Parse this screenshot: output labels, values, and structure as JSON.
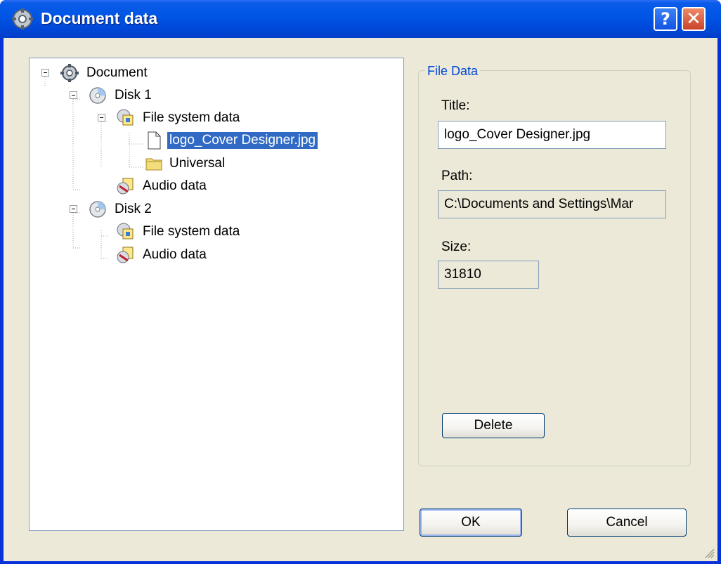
{
  "window": {
    "title": "Document data"
  },
  "titlebar_buttons": {
    "help": "?",
    "close": "✕"
  },
  "tree": {
    "root": {
      "label": "Document",
      "icon": "document-gear-icon"
    },
    "disk1": {
      "label": "Disk 1",
      "icon": "cd-disk-icon"
    },
    "disk1_fs": {
      "label": "File system data",
      "icon": "file-system-data-icon"
    },
    "disk1_file": {
      "label": "logo_Cover Designer.jpg",
      "icon": "file-icon",
      "selected": true
    },
    "disk1_folder": {
      "label": "Universal",
      "icon": "folder-icon"
    },
    "disk1_audio": {
      "label": "Audio data",
      "icon": "audio-data-icon"
    },
    "disk2": {
      "label": "Disk 2",
      "icon": "cd-disk-icon"
    },
    "disk2_fs": {
      "label": "File system data",
      "icon": "file-system-data-icon"
    },
    "disk2_audio": {
      "label": "Audio data",
      "icon": "audio-data-icon"
    }
  },
  "file_data": {
    "group_title": "File Data",
    "title_label": "Title:",
    "title_value": "logo_Cover Designer.jpg",
    "path_label": "Path:",
    "path_value": "C:\\Documents and Settings\\Mar",
    "size_label": "Size:",
    "size_value": "31810",
    "delete_button": "Delete"
  },
  "buttons": {
    "ok": "OK",
    "cancel": "Cancel"
  },
  "colors": {
    "selection": "#316ac5",
    "group_title": "#0046d5",
    "dialog_bg": "#ece9d8"
  }
}
